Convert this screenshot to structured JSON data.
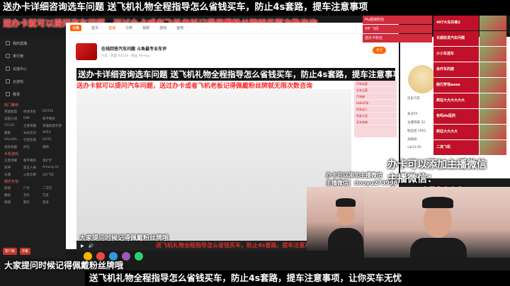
{
  "banners": {
    "top": "送办卡详细咨询选车问题  送飞机礼物全程指导怎么省钱买车，防止4s套路，提车注意事项",
    "red_line_1": "送办卡就可以提问汽车问题，送过办卡或者飞机老板记得佩戴粉丝牌就无限次数咨询",
    "black_title": "送办卡详细咨询选车问题  送飞机礼物全程指导怎么省钱买车，防止4s套路，提车注意事项",
    "red_line_2": "送办卡就可以提问汽车问题，送过办卡或者飞机老板记得佩戴粉丝牌就无限次数咨询",
    "bottom_white": "大家提问时候记得佩戴粉丝牌哦",
    "bottom_black": "送飞机礼物全程指导怎么省钱买车，防止4s套路，提车注意事项，让你买车无忧",
    "video_caption": "大家提问时候记得佩戴粉丝牌哦",
    "video_red_caption": "送飞机礼物全程指导怎么省钱买车，防止4s套路，提车注意事项"
  },
  "sidebar": {
    "items": [
      "我的直播",
      "排行榜",
      "充值中心",
      "云游戏",
      "赛事"
    ],
    "section_hot": "热门推荐",
    "hot_grid": [
      "英雄联盟",
      "绝地求生",
      "DOTA2",
      "穿越火线",
      "DNF",
      "和平精英",
      "CS:GO",
      "王者荣耀",
      "英雄联盟手游",
      "魔兽",
      "永劫无间",
      "APEX",
      "VALORA...",
      "守望先锋",
      "DOTA",
      "星际争霸",
      "炉石",
      "棋牌"
    ],
    "section_mobile": "手机游戏",
    "mobile_grid": [
      "王者荣耀",
      "和平精英",
      "金铲铲",
      "原神",
      "第五人格",
      "Among Us",
      "光遇",
      "火影忍者",
      "QQ飞车"
    ],
    "section_fun": "娱乐天地",
    "fun_grid": [
      "颜值",
      "户外",
      "二次元",
      "舞蹈",
      "音乐",
      "交友",
      "情感",
      "聊天",
      "美食"
    ],
    "bottom_buttons": [
      "客户端",
      "开播"
    ]
  },
  "topnav": {
    "logo": "斗鱼",
    "items": [
      "首页",
      "直播",
      "分类",
      "视频",
      "游戏",
      "鱼吧"
    ]
  },
  "room": {
    "title": "在线回答汽车问题 斗鱼最专业车评",
    "meta": "汽车 · 热度 93129 · 粉丝 99+kg",
    "follow": "关注"
  },
  "top_chat": [
    "My超级粉丝",
    "VIP 飞机",
    "送办卡粉丝"
  ],
  "ranks": [
    "407大车先锋2",
    "长期收发汽车问题",
    "小小车迷车",
    "会开车的鹿",
    "跑行梦境aaaa",
    "疯狂大大大大大大",
    "有吗de医药",
    "疯狂大大大大",
    "二流飞机"
  ],
  "chat_mid": [
    "汽车玩家",
    "大车之家",
    "汽车粉",
    "hello汽车",
    "问车达人",
    "车友大会",
    "买车咨询"
  ],
  "right_panel": {
    "name": "乐乐汽车",
    "line1": "关注TA",
    "line2": "主播等级 32",
    "line3": "粉丝团 1902",
    "line4": "贡献榜",
    "line5": "vip13:00"
  },
  "wechat": {
    "big_1": "办卡可以添加主播微信",
    "big_2": "主播微信：douyu273998",
    "small_1": "办卡可以添加主播微信",
    "small_2": "主播微信：douyu273998"
  }
}
